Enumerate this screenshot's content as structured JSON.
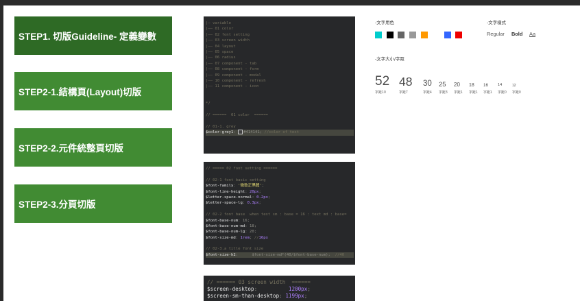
{
  "steps": [
    {
      "label": "STEP1. 切版Guideline- 定義變數",
      "color": "#2e6a25"
    },
    {
      "label": "STEP2-1.結構頁(Layout)切版",
      "color": "#418b33"
    },
    {
      "label": "STEP2-2.元件統整頁切版",
      "color": "#418b33"
    },
    {
      "label": "STEP2-3.分頁切版",
      "color": "#418b33"
    }
  ],
  "code1": [
    "|— variable",
    "|—— 01 color",
    "|—— 02 font setting",
    "|—— 03 screen width",
    "|—— 04 layout",
    "|—— 05 space",
    "|—— 06 radius",
    "|—— 07 component - tab",
    "|—— 08 component - form",
    "|—— 09 component - modal",
    "|—— 10 component - refresh",
    "|—— 11 component - icon",
    "",
    "",
    "*/",
    "",
    "// ======  01 color  ======",
    "",
    "// 01-1. grey",
    "$color-grey1: #414141; //color of text"
  ],
  "code2": [
    "// ===== 02 font setting ======",
    "",
    "// 02-1 font basic setting",
    "$font-family: '微軟正黑體';",
    "$font-line-height: 20px;",
    "$letter-space-normal: 0.2px;",
    "$letter-space-lg: 0.3px;",
    "",
    "// 02-2 font base  when text sm : base = 16 : text md : base=",
    "$font-base-num: 16;",
    "$font-base-num-md: 18;",
    "$font-base-num-lg: 20;",
    "$font-size-md: 1rem; //16px",
    "",
    "// 02-3.a title font size",
    "$font-size-h2:      $font-size-md*(40/$font-base-num);  //40"
  ],
  "code3": [
    "// ====== 03 screen width  ======",
    "$screen-desktop:          1200px;",
    "$screen-sm-than-desktop: 1199px;"
  ],
  "guide": {
    "color_title": "-文字用色",
    "colors": [
      "#00cccc",
      "#000000",
      "#666666",
      "#999999",
      "#ff9900",
      "#ffffff",
      "#3366ff",
      "#ee0000"
    ],
    "style_title": "-文字樣式",
    "styles": [
      "Regular",
      "Bold",
      "Aa"
    ],
    "size_title": "-文字大小/字距",
    "sizes": [
      {
        "num": "52",
        "cap": "字距10"
      },
      {
        "num": "48",
        "cap": "字距7"
      },
      {
        "num": "30",
        "cap": "字距4"
      },
      {
        "num": "25",
        "cap": "字距3"
      },
      {
        "num": "20",
        "cap": "字距1"
      },
      {
        "num": "18",
        "cap": "字距1"
      },
      {
        "num": "16",
        "cap": "字距1"
      },
      {
        "num": "14",
        "cap": "字距0"
      },
      {
        "num": "12",
        "cap": "字距0"
      }
    ]
  }
}
